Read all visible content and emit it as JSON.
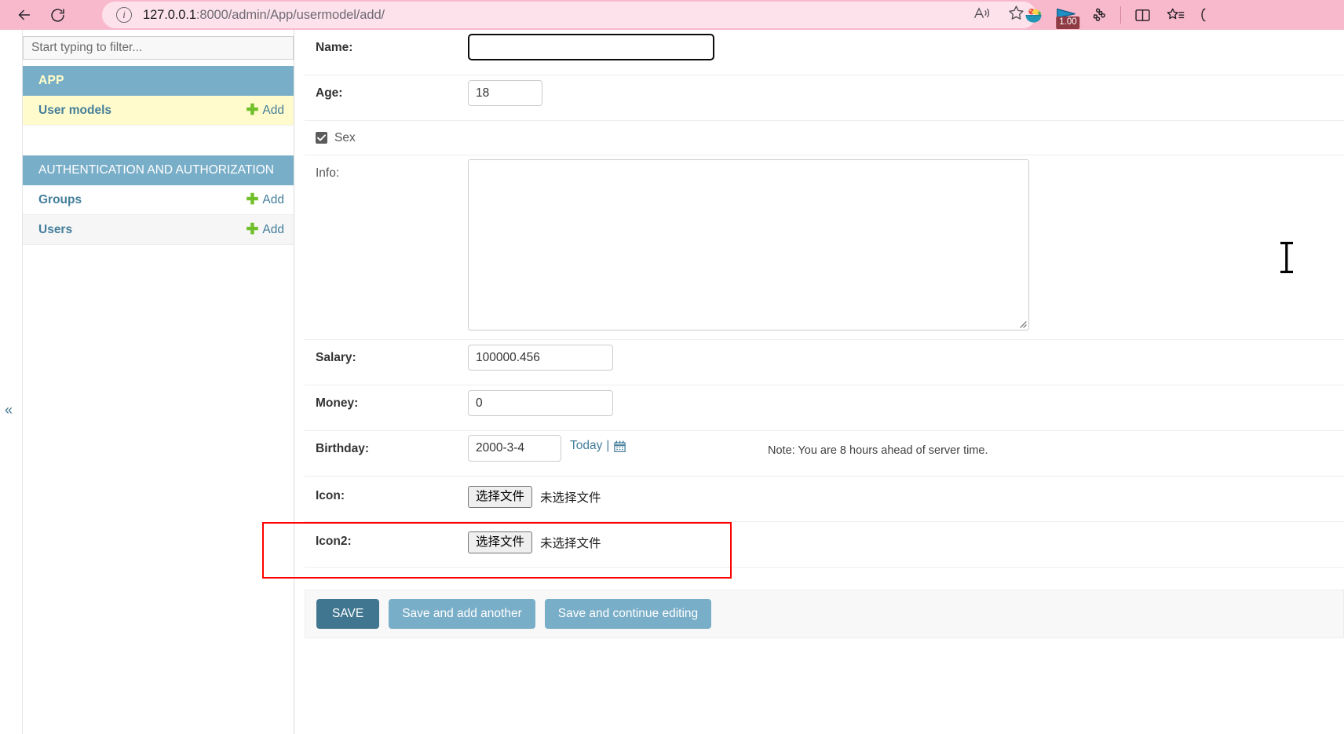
{
  "browser": {
    "back_label": "Back",
    "reload_label": "Refresh",
    "url_prefix": "127.0.0.1",
    "url_suffix": ":8000/admin/App/usermodel/add/",
    "read_aloud_label": "Read aloud",
    "favorite_label": "Add this page to favorites",
    "fruit_ext_label": "Fruit extension",
    "flag_ext_label": "Flag extension",
    "flag_badge": "1.00",
    "extensions_label": "Extensions",
    "split_screen_label": "Split screen",
    "collections_label": "Collections",
    "profile_label": "Profile"
  },
  "sidebar": {
    "filter_placeholder": "Start typing to filter...",
    "collapse_label": "«",
    "groups": [
      {
        "title": "APP",
        "items": [
          {
            "label": "User models",
            "add_label": "Add",
            "highlight": true
          }
        ]
      },
      {
        "title": "AUTHENTICATION AND AUTHORIZATION",
        "items": [
          {
            "label": "Groups",
            "add_label": "Add",
            "highlight": false
          },
          {
            "label": "Users",
            "add_label": "Add",
            "highlight": false
          }
        ]
      }
    ]
  },
  "form": {
    "name": {
      "label": "Name:",
      "value": ""
    },
    "age": {
      "label": "Age:",
      "value": "18"
    },
    "sex": {
      "label": "Sex",
      "checked": true
    },
    "info": {
      "label": "Info:",
      "value": ""
    },
    "salary": {
      "label": "Salary:",
      "value": "100000.456"
    },
    "money": {
      "label": "Money:",
      "value": "0"
    },
    "birthday": {
      "label": "Birthday:",
      "value": "2000-3-4",
      "today_label": "Today",
      "separator": "|",
      "calendar_label": "calendar",
      "timezone_note": "Note: You are 8 hours ahead of server time."
    },
    "icon": {
      "label": "Icon:",
      "button_label": "选择文件",
      "status": "未选择文件"
    },
    "icon2": {
      "label": "Icon2:",
      "button_label": "选择文件",
      "status": "未选择文件"
    }
  },
  "submit": {
    "save": "SAVE",
    "save_and_add_another": "Save and add another",
    "save_and_continue": "Save and continue editing"
  },
  "colors": {
    "browser_chrome": "#f9b9cd",
    "address_bar": "#fde2eb",
    "django_header": "#79aec8",
    "django_primary": "#417690",
    "highlight_row": "#fffbcc",
    "add_plus": "#70bf2b",
    "highlight_box": "#ff0000"
  }
}
